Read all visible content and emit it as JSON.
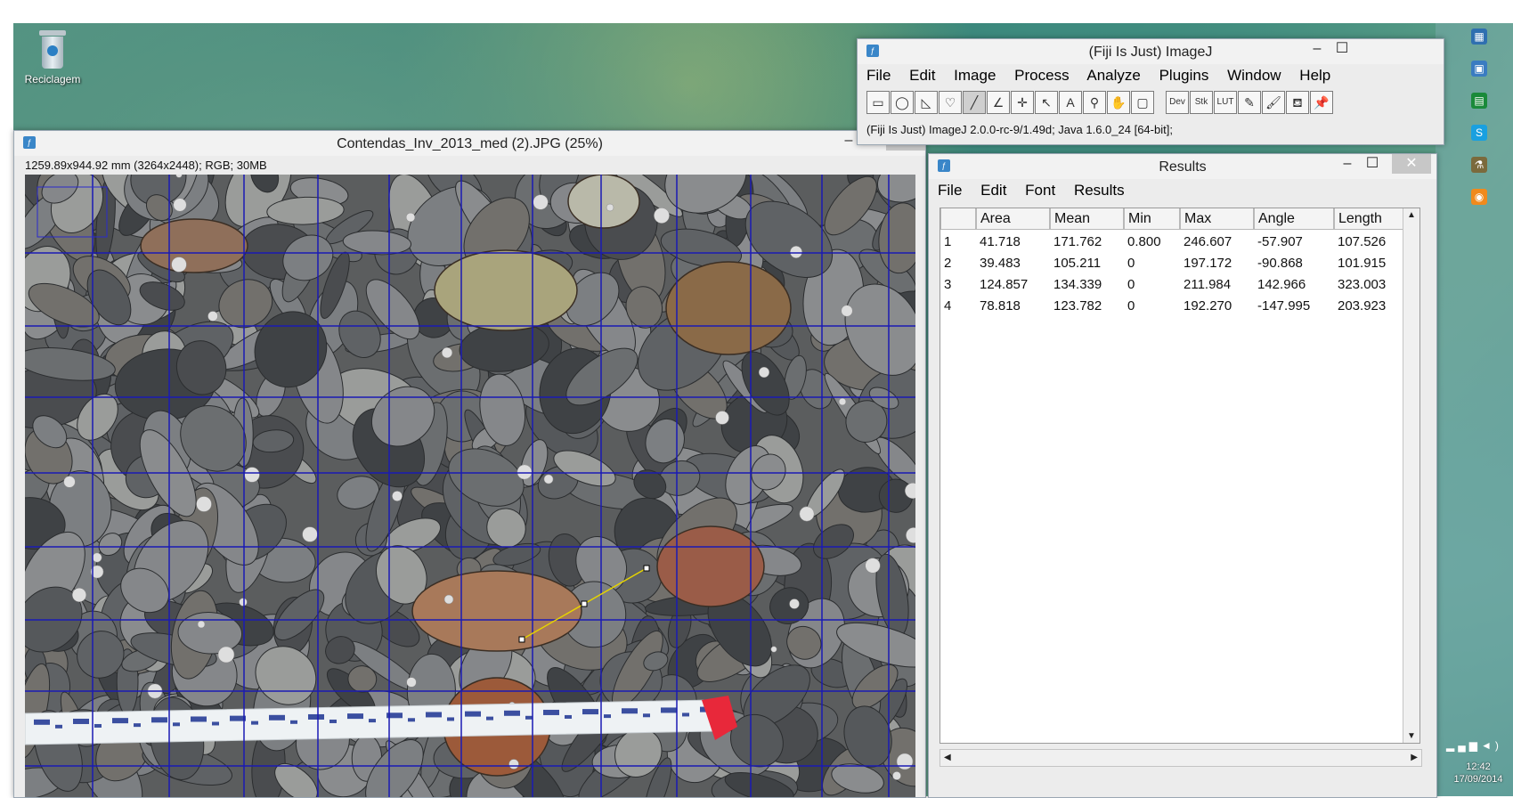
{
  "desktop": {
    "icon_label": "Reciclagem"
  },
  "taskbar": {
    "time": "12:42",
    "date": "17/09/2014"
  },
  "imagej": {
    "title": "(Fiji Is Just) ImageJ",
    "menu": [
      "File",
      "Edit",
      "Image",
      "Process",
      "Analyze",
      "Plugins",
      "Window",
      "Help"
    ],
    "tools": [
      "rect",
      "oval",
      "polygon",
      "freehand",
      "line",
      "angle",
      "point",
      "wand",
      "text",
      "zoom",
      "hand",
      "color",
      "Dev",
      "Stk",
      "LUT",
      "pencil",
      "brush",
      "flood-fill",
      "pin"
    ],
    "status": "(Fiji Is Just) ImageJ 2.0.0-rc-9/1.49d; Java 1.6.0_24 [64-bit];"
  },
  "image_window": {
    "title": "Contendas_Inv_2013_med (2).JPG (25%)",
    "info": "1259.89x944.92 mm (3264x2448); RGB; 30MB"
  },
  "results": {
    "title": "Results",
    "menu": [
      "File",
      "Edit",
      "Font",
      "Results"
    ],
    "columns": [
      "",
      "Area",
      "Mean",
      "Min",
      "Max",
      "Angle",
      "Length"
    ],
    "rows": [
      [
        "1",
        "41.718",
        "171.762",
        "0.800",
        "246.607",
        "-57.907",
        "107.526"
      ],
      [
        "2",
        "39.483",
        "105.211",
        "0",
        "197.172",
        "-90.868",
        "101.915"
      ],
      [
        "3",
        "124.857",
        "134.339",
        "0",
        "211.984",
        "142.966",
        "323.003"
      ],
      [
        "4",
        "78.818",
        "123.782",
        "0",
        "192.270",
        "-147.995",
        "203.923"
      ]
    ]
  },
  "colors": {
    "grid": "#1a1ab4",
    "selection_line": "#e6d400",
    "close_button": "#c7c7c7"
  }
}
